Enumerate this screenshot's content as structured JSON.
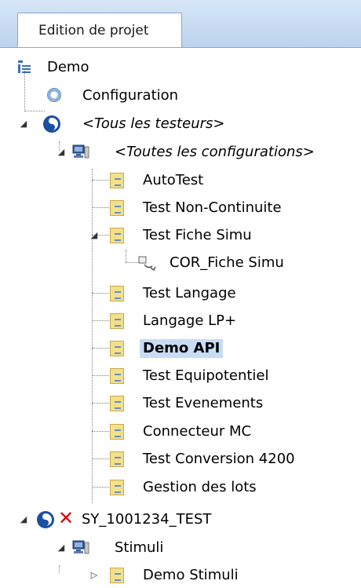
{
  "tab": {
    "label": "Edition de projet"
  },
  "tree": {
    "root": "Demo",
    "configuration": "Configuration",
    "all_testers": "<Tous les testeurs>",
    "all_configurations": "<Toutes les configurations>",
    "items": [
      "AutoTest",
      "Test Non-Continuite",
      "Test Fiche Simu",
      "COR_Fiche Simu",
      "Test Langage",
      "Langage LP+",
      "Demo API",
      "Test Equipotentiel",
      "Test Evenements",
      "Connecteur MC",
      "Test Conversion 4200",
      "Gestion des lots"
    ],
    "tester": "SY_1001234_TEST",
    "stimuli": "Stimuli",
    "demo_stimuli": "Demo Stimuli",
    "selected_item": "Demo API"
  }
}
